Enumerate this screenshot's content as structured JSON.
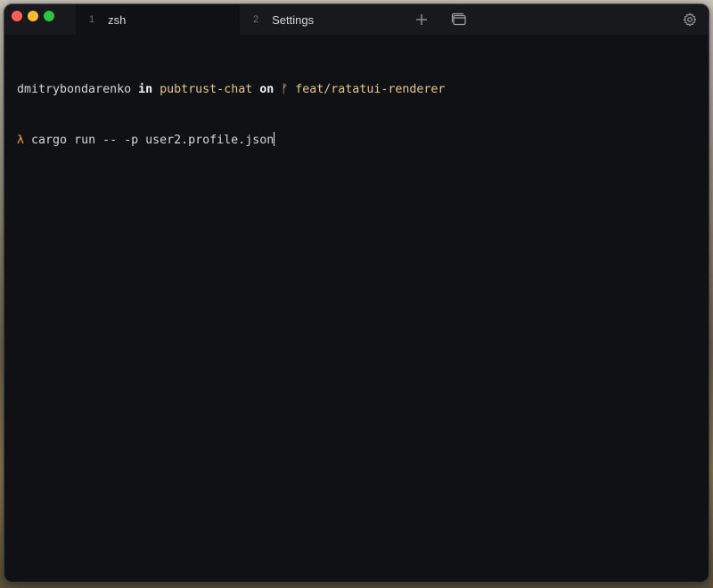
{
  "tabs": [
    {
      "index": "1",
      "label": "zsh",
      "active": true
    },
    {
      "index": "2",
      "label": "Settings",
      "active": false
    }
  ],
  "toolbar": {
    "new_tab_icon": "plus-icon",
    "windows_icon": "window-stack-icon",
    "settings_icon": "gear-icon"
  },
  "prompt": {
    "user": "dmitrybondarenko",
    "in_word": "in",
    "directory": "pubtrust-chat",
    "on_word": "on",
    "branch_glyph": "ᚠ",
    "branch": "feat/ratatui-renderer",
    "symbol": "λ",
    "command": "cargo run -- -p user2.profile.json"
  },
  "colors": {
    "terminal_bg": "#0f1114",
    "titlebar_bg": "#17191c",
    "path_yellow": "#e3c68d",
    "lambda_orange": "#f0a35a",
    "close": "#ff5f57",
    "minimize": "#febc2e",
    "maximize": "#28c840"
  }
}
